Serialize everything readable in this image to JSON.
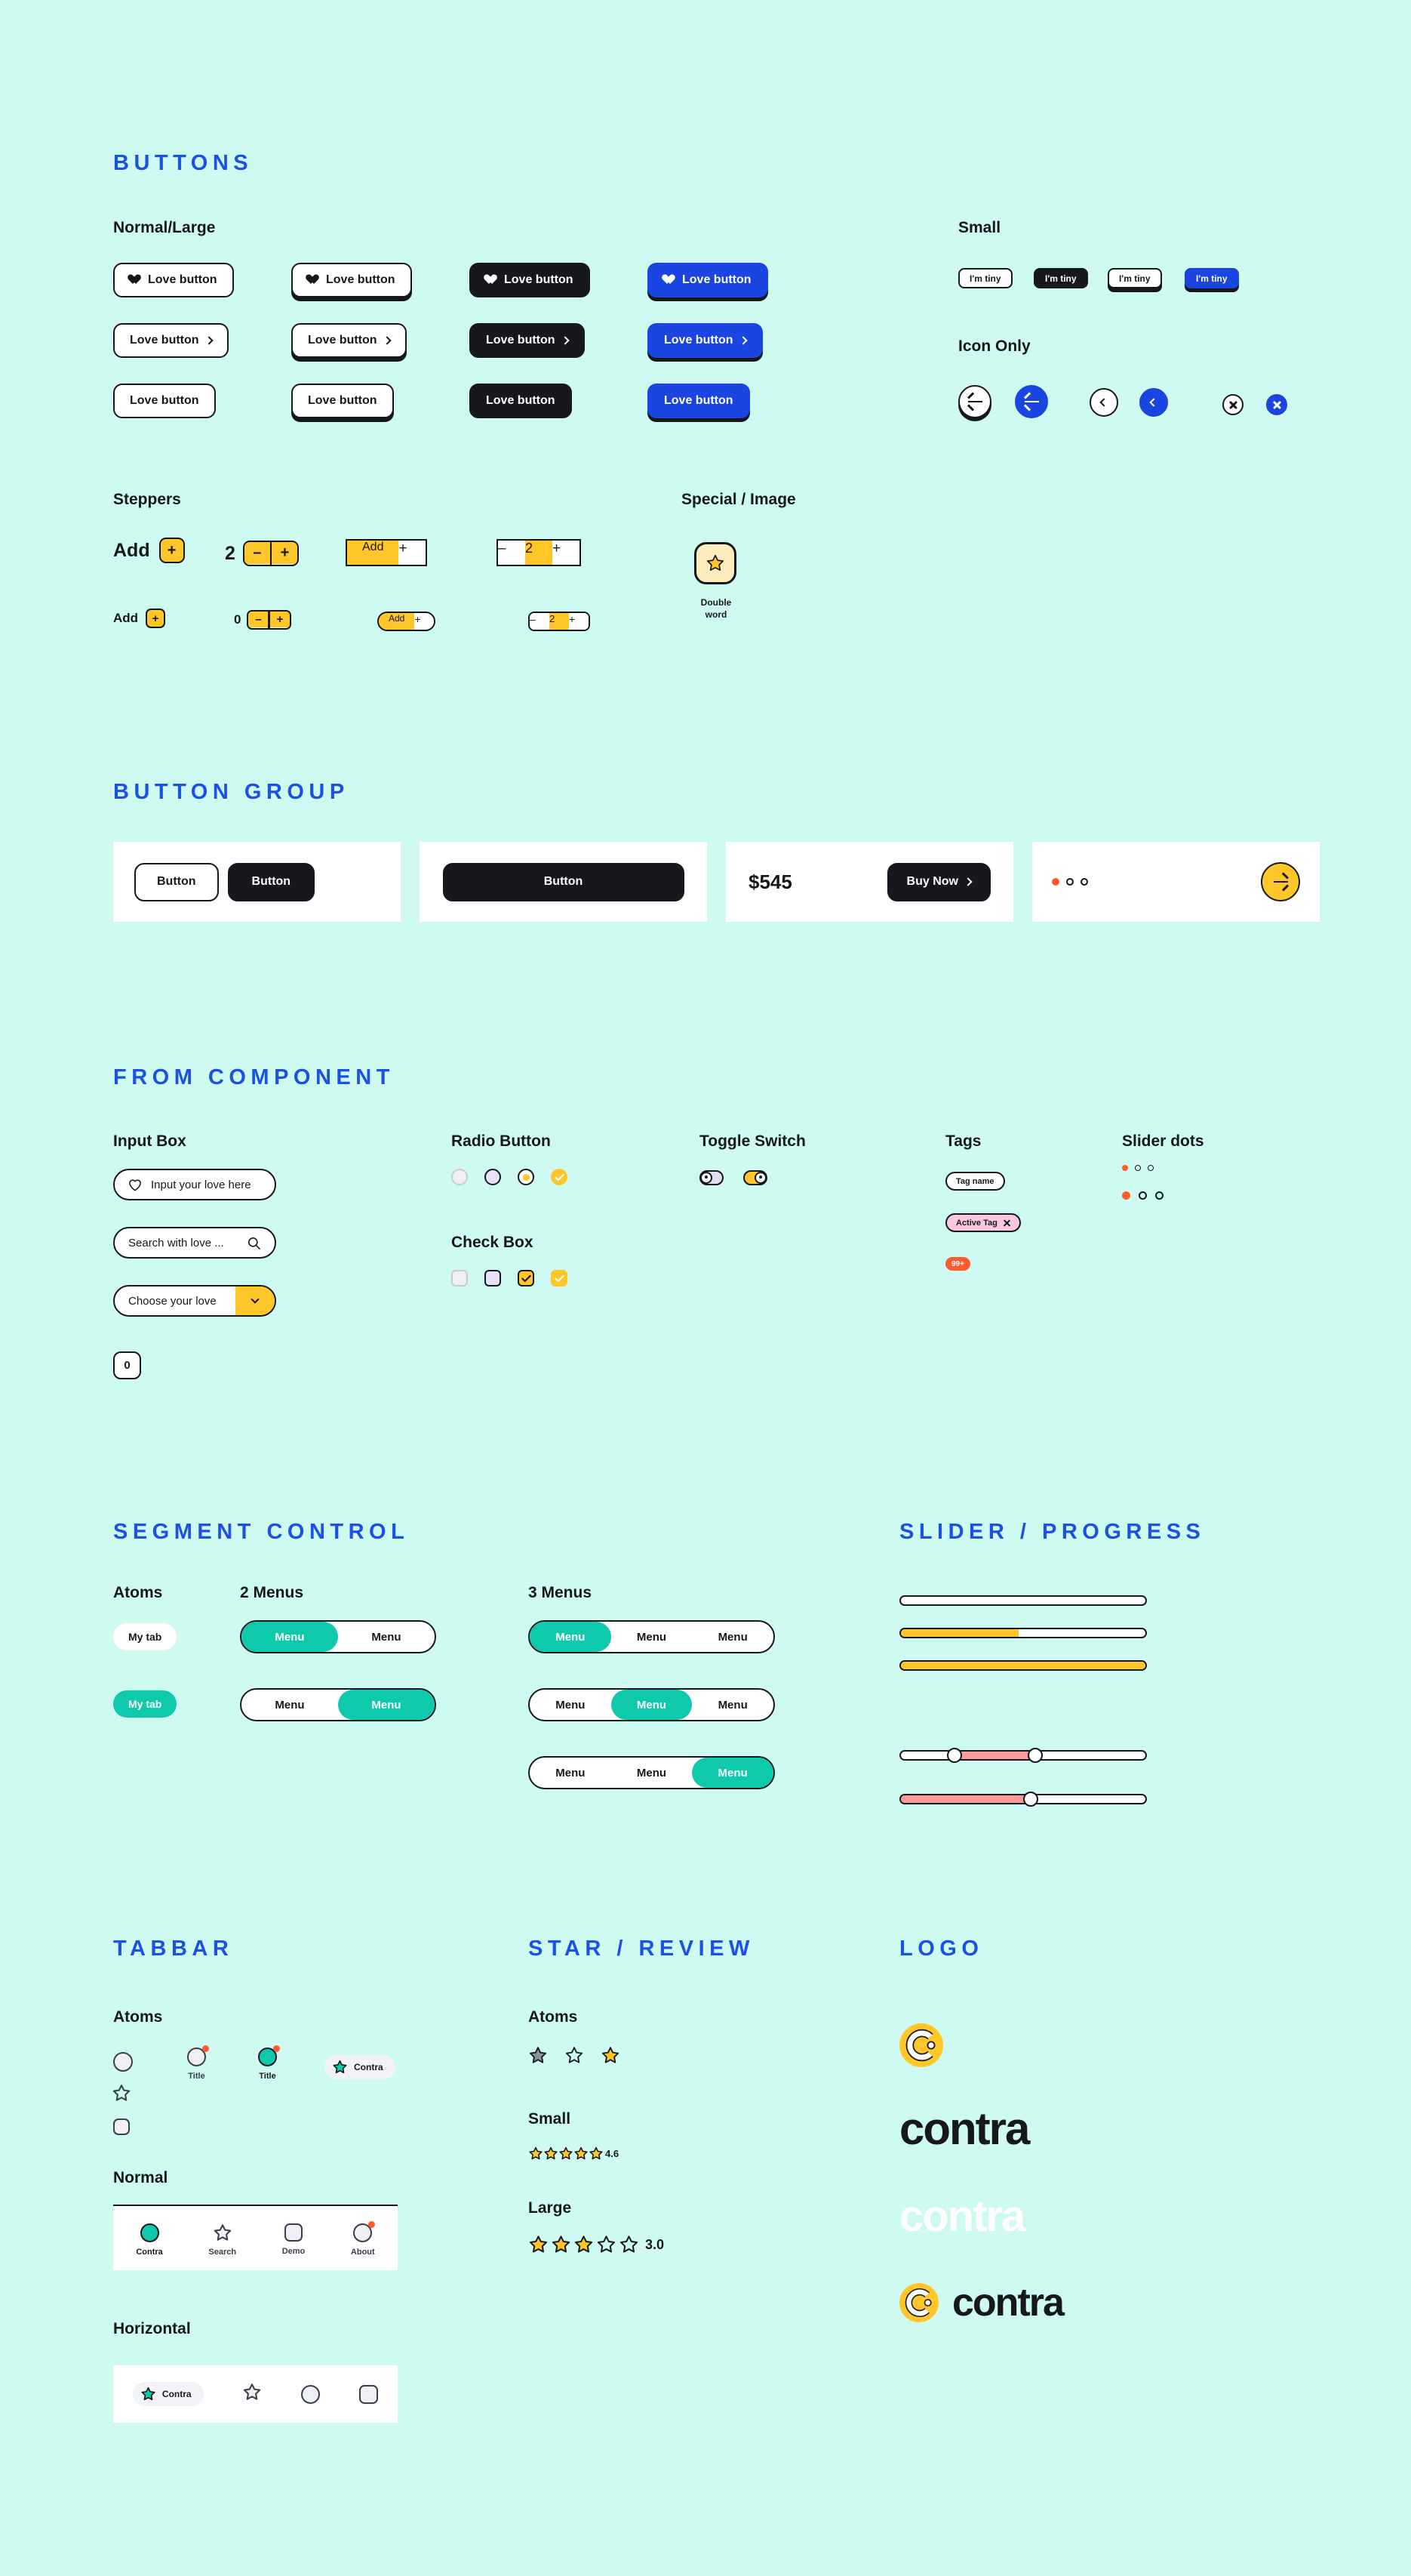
{
  "colors": {
    "background": "#CFFAF2",
    "accent_blue": "#1B45E0",
    "heading_blue": "#1B51E5",
    "dark": "#16181D",
    "yellow": "#FFC629",
    "teal": "#0FC9AC",
    "orange": "#FF5B2E",
    "pink": "#FBC7DC",
    "salmon": "#F89A9A",
    "cream": "#FDECBC"
  },
  "sections": {
    "buttons": {
      "title": "BUTTONS",
      "normal_large_label": "Normal/Large",
      "small_label": "Small",
      "icon_only_label": "Icon Only",
      "steppers_label": "Steppers",
      "special_label": "Special / Image",
      "love_button": "Love button",
      "tiny_button": "I'm tiny",
      "icons": [
        "heart-icon",
        "chevron-right-icon",
        "arrow-left-icon",
        "chevron-left-icon",
        "close-icon"
      ]
    },
    "steppers": {
      "add_label": "Add",
      "plus": "+",
      "minus": "–",
      "value_two": "2",
      "value_zero": "0"
    },
    "special": {
      "card_icon": "star-icon",
      "caption_line1": "Double",
      "caption_line2": "word"
    },
    "button_group": {
      "title": "BUTTON GROUP",
      "button_label": "Button",
      "price": "$545",
      "buy_now": "Buy Now",
      "arrow_icon": "arrow-right-icon",
      "dots": 3,
      "active_dot": 0
    },
    "from_component": {
      "title": "FROM COMPONENT",
      "input_box_label": "Input Box",
      "radio_label": "Radio Button",
      "checkbox_label": "Check Box",
      "toggle_label": "Toggle Switch",
      "tags_label": "Tags",
      "slider_dots_label": "Slider dots",
      "inputs": [
        {
          "icon": "heart-icon",
          "placeholder": "Input your love here"
        },
        {
          "icon": "search-icon",
          "placeholder": "Search with love ..."
        },
        {
          "icon": "chevron-down-icon",
          "placeholder": "Choose your love"
        }
      ],
      "counter_value": "0",
      "tags": {
        "plain": "Tag name",
        "active": "Active Tag",
        "active_close_icon": "close-icon",
        "badge": "99+"
      }
    },
    "segment_control": {
      "title": "SEGMENT CONTROL",
      "atoms_label": "Atoms",
      "two_menus_label": "2 Menus",
      "three_menus_label": "3 Menus",
      "tab_label": "My tab",
      "menu_label": "Menu",
      "two_menu_rows": [
        {
          "items": [
            "Menu",
            "Menu"
          ],
          "active": 0
        },
        {
          "items": [
            "Menu",
            "Menu"
          ],
          "active": 1
        }
      ],
      "three_menu_rows": [
        {
          "items": [
            "Menu",
            "Menu",
            "Menu"
          ],
          "active": 0
        },
        {
          "items": [
            "Menu",
            "Menu",
            "Menu"
          ],
          "active": 1
        },
        {
          "items": [
            "Menu",
            "Menu",
            "Menu"
          ],
          "active": 2
        }
      ]
    },
    "slider_progress": {
      "title": "SLIDER / PROGRESS",
      "bars": [
        {
          "name": "empty",
          "fill_percent": 0
        },
        {
          "name": "partial",
          "fill_percent": 48
        },
        {
          "name": "full",
          "fill_percent": 100
        }
      ],
      "sliders": [
        {
          "name": "range",
          "lower_percent": 22,
          "upper_percent": 55
        },
        {
          "name": "single",
          "value_percent": 53
        }
      ]
    },
    "tabbar": {
      "title": "TABBAR",
      "atoms_label": "Atoms",
      "normal_label": "Normal",
      "horizontal_label": "Horizontal",
      "atom_title": "Title",
      "brand_chip": "Contra",
      "normal_items": [
        {
          "label": "Contra",
          "icon": "circle-filled-icon",
          "active": true,
          "badge": false
        },
        {
          "label": "Search",
          "icon": "star-icon",
          "active": false,
          "badge": false
        },
        {
          "label": "Demo",
          "icon": "square-icon",
          "active": false,
          "badge": false
        },
        {
          "label": "About",
          "icon": "circle-icon",
          "active": false,
          "badge": true
        }
      ],
      "horizontal_items": [
        {
          "label": "Contra",
          "icon": "star-icon",
          "active": true
        },
        {
          "label": "",
          "icon": "star-icon",
          "active": false
        },
        {
          "label": "",
          "icon": "circle-icon",
          "active": false
        },
        {
          "label": "",
          "icon": "square-icon",
          "active": false
        }
      ]
    },
    "star_review": {
      "title": "STAR / REVIEW",
      "atoms_label": "Atoms",
      "small_label": "Small",
      "large_label": "Large",
      "small_rating": "4.6",
      "small_filled": 5,
      "small_total": 5,
      "large_rating": "3.0",
      "large_filled": 3,
      "large_total": 5
    },
    "logo": {
      "title": "LOGO",
      "wordmark": "contra",
      "mark_icon": "contra-c-mark-icon",
      "variants": [
        "mark-only",
        "wordmark-dark",
        "wordmark-white",
        "mark-plus-wordmark"
      ]
    }
  }
}
